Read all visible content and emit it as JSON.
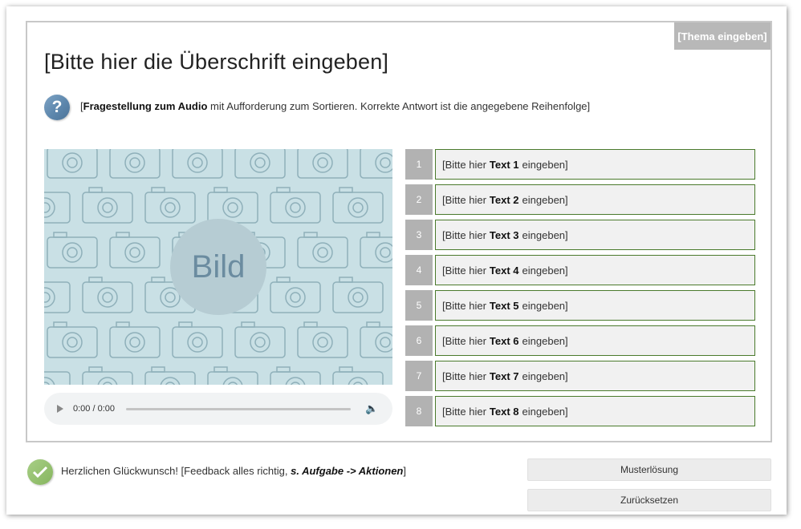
{
  "topic": "[Thema eingeben]",
  "heading": "[Bitte hier die Überschrift eingeben]",
  "question": {
    "open": "[",
    "bold": "Fragestellung zum Audio",
    "rest": " mit Aufforderung zum Sortieren. Korrekte Antwort ist die angegebene Reihenfolge]",
    "icon": "question-icon",
    "icon_color": "#6a93b8"
  },
  "image": {
    "label": "Bild",
    "background": "#c9e0e5",
    "pattern": "camera-icon"
  },
  "audio": {
    "time": "0:00 / 0:00",
    "icons": [
      "play-icon",
      "volume-icon"
    ]
  },
  "items": [
    {
      "number": "1",
      "prefix": "[Bitte hier",
      "bold": "Text 1",
      "suffix": "eingeben]"
    },
    {
      "number": "2",
      "prefix": "[Bitte hier",
      "bold": "Text 2",
      "suffix": "eingeben]"
    },
    {
      "number": "3",
      "prefix": "[Bitte hier",
      "bold": "Text 3",
      "suffix": "eingeben]"
    },
    {
      "number": "4",
      "prefix": "[Bitte hier",
      "bold": "Text 4",
      "suffix": "eingeben]"
    },
    {
      "number": "5",
      "prefix": "[Bitte hier",
      "bold": "Text 5",
      "suffix": "eingeben]"
    },
    {
      "number": "6",
      "prefix": "[Bitte hier",
      "bold": "Text 6",
      "suffix": "eingeben]"
    },
    {
      "number": "7",
      "prefix": "[Bitte hier",
      "bold": "Text 7",
      "suffix": "eingeben]"
    },
    {
      "number": "8",
      "prefix": "[Bitte hier",
      "bold": "Text 8",
      "suffix": "eingeben]"
    }
  ],
  "feedback": {
    "text": "Herzlichen Glückwunsch! [Feedback alles richtig, ",
    "bold": "s. Aufgabe -> Aktionen",
    "close": "]",
    "icon": "checkmark-icon",
    "icon_color": "#8fbf68"
  },
  "buttons": {
    "solution": "Musterlösung",
    "reset": "Zurücksetzen"
  },
  "colors": {
    "item_border": "#4a7a2c",
    "number_bg": "#b2b2b2",
    "topic_bg": "#b8b8b8"
  }
}
